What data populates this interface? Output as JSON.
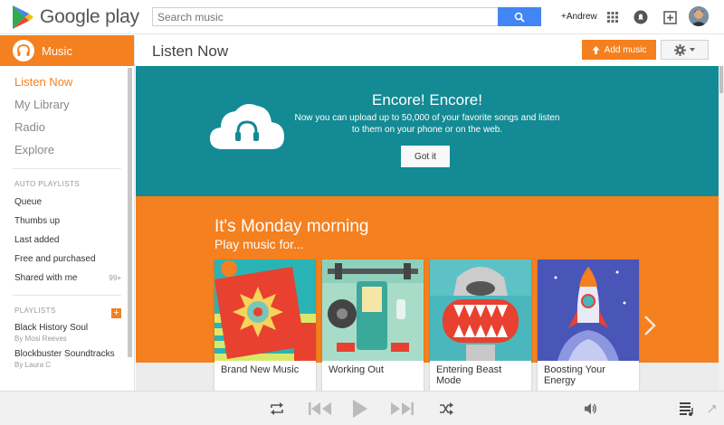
{
  "header": {
    "logo_text": "Google play",
    "search_placeholder": "Search music",
    "user_label": "+Andrew"
  },
  "sidebar": {
    "section_label": "Music",
    "nav": [
      {
        "label": "Listen Now",
        "active": true
      },
      {
        "label": "My Library",
        "active": false
      },
      {
        "label": "Radio",
        "active": false
      },
      {
        "label": "Explore",
        "active": false
      }
    ],
    "auto_playlists_title": "AUTO PLAYLISTS",
    "auto_playlists": [
      {
        "label": "Queue",
        "count": ""
      },
      {
        "label": "Thumbs up",
        "count": ""
      },
      {
        "label": "Last added",
        "count": ""
      },
      {
        "label": "Free and purchased",
        "count": ""
      },
      {
        "label": "Shared with me",
        "count": "99+"
      }
    ],
    "playlists_title": "PLAYLISTS",
    "add_label": "+",
    "playlists": [
      {
        "name": "Black History Soul",
        "by": "By Mosi Reeves"
      },
      {
        "name": "Blockbuster Soundtracks",
        "by": "By Laura C"
      }
    ]
  },
  "main": {
    "page_title": "Listen Now",
    "add_music_label": "Add music",
    "encore": {
      "title": "Encore! Encore!",
      "text": "Now you can upload up to 50,000 of your favorite songs and listen to them on your phone or on the web.",
      "button": "Got it"
    },
    "monday": {
      "title": "It's Monday morning",
      "subtitle": "Play music for...",
      "cards": [
        {
          "label": "Brand New Music"
        },
        {
          "label": "Working Out"
        },
        {
          "label": "Entering Beast Mode"
        },
        {
          "label": "Boosting Your Energy"
        }
      ]
    }
  },
  "colors": {
    "accent": "#f4801f",
    "teal": "#138a94",
    "search_blue": "#4285f4"
  }
}
